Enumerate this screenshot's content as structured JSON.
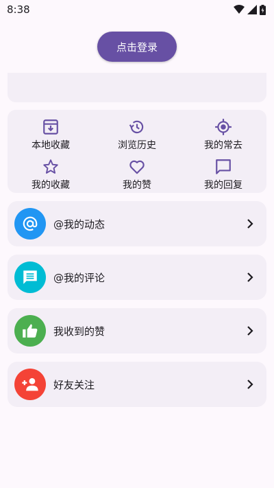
{
  "status_bar": {
    "time": "8:38",
    "icons": [
      "wifi-icon",
      "signal-icon",
      "battery-icon"
    ]
  },
  "header": {
    "login_label": "点击登录"
  },
  "quick_actions": [
    {
      "label": "本地收藏",
      "icon": "archive-down-icon"
    },
    {
      "label": "浏览历史",
      "icon": "history-icon"
    },
    {
      "label": "我的常去",
      "icon": "location-target-icon"
    },
    {
      "label": "我的收藏",
      "icon": "star-icon"
    },
    {
      "label": "我的赞",
      "icon": "heart-icon"
    },
    {
      "label": "我的回复",
      "icon": "comment-icon"
    }
  ],
  "list": [
    {
      "label": "@我的动态",
      "icon": "at-icon",
      "color": "#2196f3"
    },
    {
      "label": "@我的评论",
      "icon": "message-icon",
      "color": "#00bcd4"
    },
    {
      "label": "我收到的赞",
      "icon": "thumb-up-icon",
      "color": "#4caf50"
    },
    {
      "label": "好友关注",
      "icon": "person-add-icon",
      "color": "#f44336"
    }
  ],
  "colors": {
    "accent": "#6750a4",
    "card": "#f3eef6",
    "background": "#fdf8fd"
  }
}
